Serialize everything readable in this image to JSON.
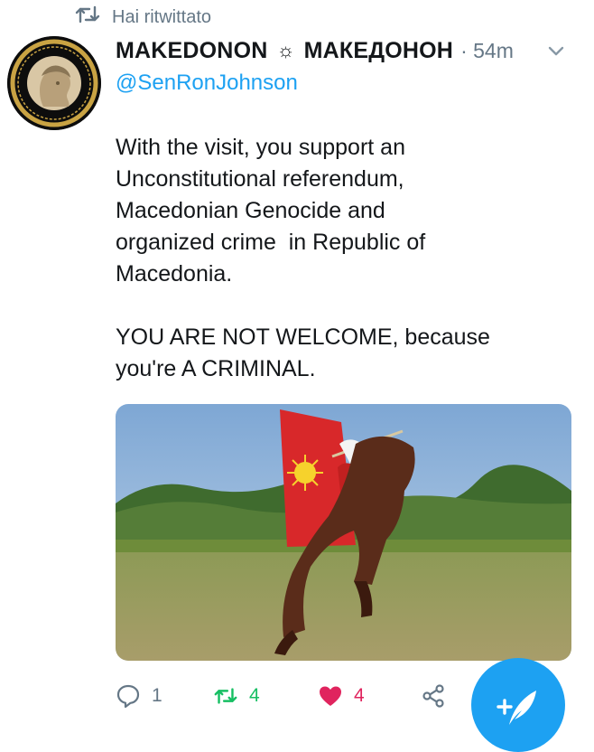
{
  "retweet_context": {
    "label": "Hai ritwittato",
    "icon": "retweet-icon"
  },
  "tweet": {
    "display_name_1": "MAKEDONON",
    "separator": "☼",
    "display_name_2": "МАКЕДОНОН",
    "time": "· 54m",
    "reply_to": "@SenRonJohnson",
    "text": "With the visit, you support an\nUnconstitutional referendum,\nMacedonian Genocide and\norganized crime  in Republic of\nMacedonia.\n\nYOU ARE NOT WELCOME, because\nyou're A CRIMINAL.",
    "avatar_icon": "profile-avatar",
    "menu_icon": "chevron-down-icon"
  },
  "actions": {
    "reply_count": "1",
    "retweet_count": "4",
    "like_count": "4"
  },
  "colors": {
    "accent": "#1da1f2",
    "muted": "#657786",
    "retweet_green": "#17bf63",
    "like_red": "#e0245e",
    "text": "#14171a"
  },
  "fab": {
    "icon": "compose-tweet-icon"
  }
}
